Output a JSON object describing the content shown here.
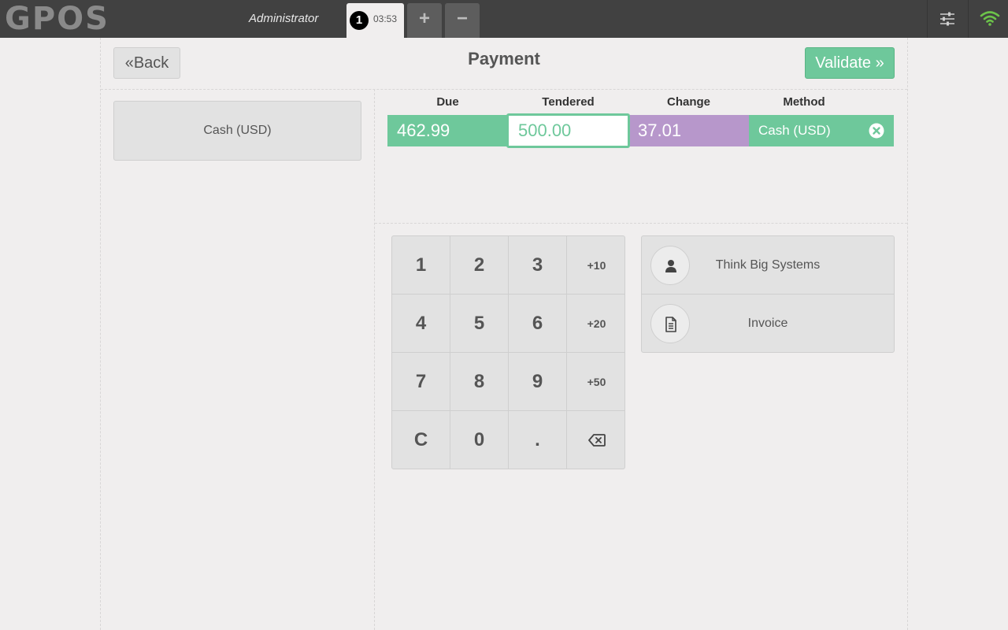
{
  "app": {
    "logo": "GPOS",
    "user": "Administrator",
    "order_tab": {
      "number": "1",
      "time": "03:53"
    },
    "add_order": "+",
    "remove_order": "−"
  },
  "header": {
    "back_label": "Back",
    "title": "Payment",
    "validate_label": "Validate"
  },
  "payment_methods": [
    "Cash (USD)"
  ],
  "payment_table": {
    "columns": [
      "Due",
      "Tendered",
      "Change",
      "Method"
    ],
    "line": {
      "due": "462.99",
      "tendered": "500.00",
      "change": "37.01",
      "method": "Cash (USD)"
    }
  },
  "numpad": {
    "keys": [
      [
        "1",
        "2",
        "3",
        "+10"
      ],
      [
        "4",
        "5",
        "6",
        "+20"
      ],
      [
        "7",
        "8",
        "9",
        "+50"
      ],
      [
        "C",
        "0",
        ".",
        "⌫"
      ]
    ]
  },
  "side_actions": {
    "customer": "Think Big Systems",
    "invoice": "Invoice"
  },
  "colors": {
    "accent_green": "#6ec89b",
    "change_purple": "#b797cb",
    "topbar": "#414141",
    "wifi_green": "#6cc24a"
  },
  "icons": {
    "settings": "sliders-icon",
    "wifi": "wifi-icon",
    "delete": "close-circle-icon",
    "customer": "user-icon",
    "invoice": "document-icon",
    "backspace": "backspace-icon"
  }
}
